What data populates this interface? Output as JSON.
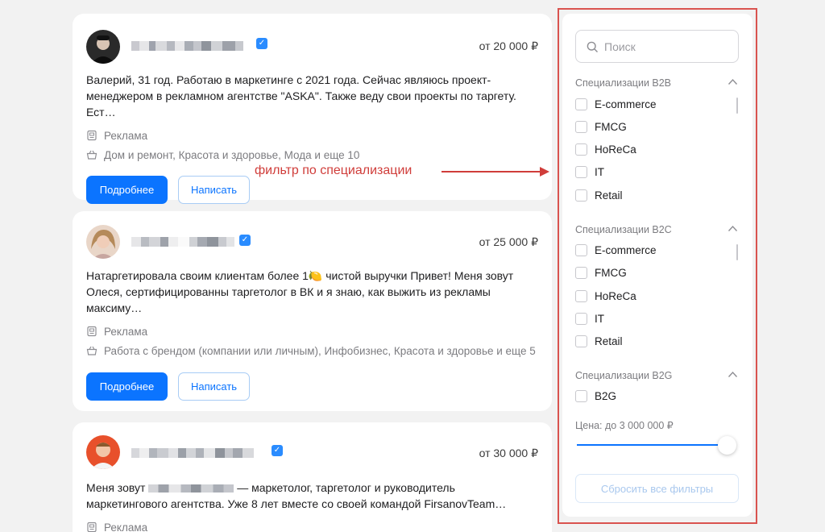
{
  "cards": [
    {
      "price": "от 20 000 ₽",
      "description": "Валерий, 31 год. Работаю в маркетинге с 2021 года. Сейчас являюсь проект-менеджером в рекламном агентстве \"ASKA\". Также веду свои проекты по таргету. Ест…",
      "category": "Реклама",
      "niches": "Дом и ремонт, Красота и здоровье, Мода и еще 10",
      "more_label": "Подробнее",
      "write_label": "Написать"
    },
    {
      "price": "от 25 000 ₽",
      "description": "Натаргетировала своим клиентам более 1🍋 чистой выручки Привет! Меня зовут Олеся, сертифицированны таргетолог в ВК и я знаю, как выжить из рекламы максиму…",
      "category": "Реклама",
      "niches": "Работа с брендом (компании или личным), Инфобизнес, Красота и здоровье и еще 5",
      "more_label": "Подробнее",
      "write_label": "Написать"
    },
    {
      "price": "от 30 000 ₽",
      "description_start": "Меня зовут",
      "description_end": "— маркетолог, таргетолог и руководитель маркетингового агентства. Уже 8 лет вместе со своей командой FirsanovTeam…",
      "category": "Реклама"
    }
  ],
  "annotation": "фильтр по специализации",
  "filters": {
    "search_placeholder": "Поиск",
    "groups": [
      {
        "title": "Специализации B2B",
        "options": [
          "E-commerce",
          "FMCG",
          "HoReCa",
          "IT",
          "Retail"
        ]
      },
      {
        "title": "Специализации B2C",
        "options": [
          "E-commerce",
          "FMCG",
          "HoReCa",
          "IT",
          "Retail"
        ]
      },
      {
        "title": "Специализации B2G",
        "options": [
          "B2G"
        ]
      }
    ],
    "price_label": "Цена: до 3 000 000 ₽",
    "price_level": 1.0,
    "reset_label": "Сбросить все фильтры"
  },
  "colors": {
    "accent": "#0b74ff",
    "annotation": "#d03d3a",
    "page_bg": "#f2f2f2"
  },
  "icons": [
    "verified-icon",
    "briefcase-icon",
    "basket-icon",
    "search-icon",
    "chevron-up-icon",
    "arrow-right-icon"
  ]
}
